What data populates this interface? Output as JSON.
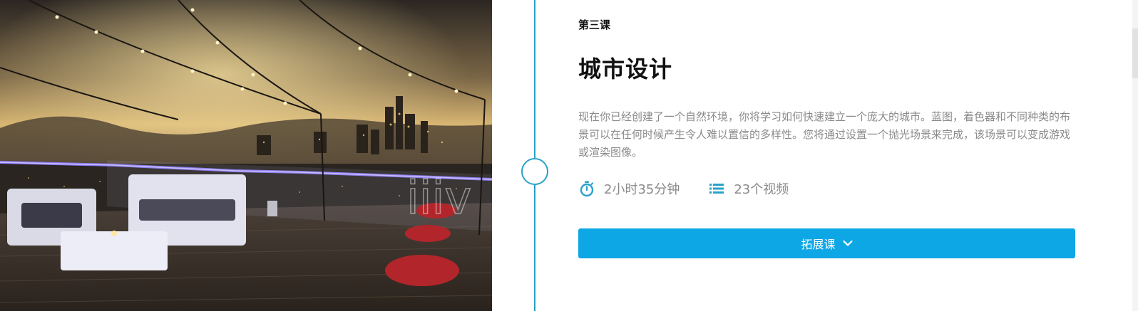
{
  "lesson": {
    "number_label": "第三课",
    "title": "城市设计",
    "description": "现在你已经创建了一个自然环境，你将学习如何快速建立一个庞大的城市。蓝图，着色器和不同种类的布景可以在任何时候产生令人难以置信的多样性。您将通过设置一个抛光场景来完成，该场景可以变成游戏或渲染图像。",
    "duration": "2小时35分钟",
    "video_count": "23个视频",
    "expand_label": "拓展课"
  },
  "hero": {
    "watermark": "iiiv"
  },
  "icons": {
    "duration": "stopwatch-icon",
    "videos": "list-icon",
    "expand": "chevron-down-icon"
  },
  "colors": {
    "accent": "#2aa1c9",
    "button": "#0ea7e6",
    "text": "#111111",
    "muted": "#8a8a8a"
  }
}
